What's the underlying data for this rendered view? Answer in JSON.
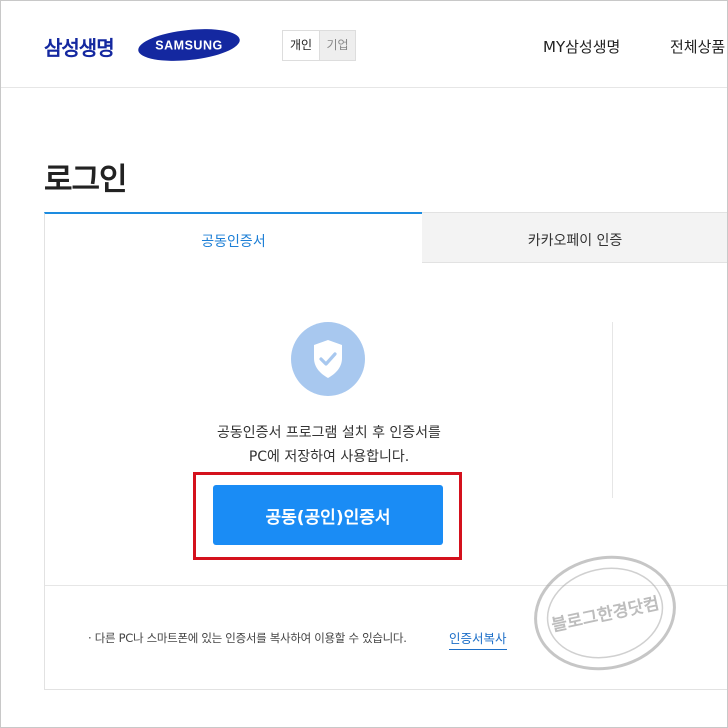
{
  "header": {
    "brand": "삼성생명",
    "partner_logo": "SAMSUNG",
    "segments": [
      "개인",
      "기업"
    ],
    "nav": [
      "MY삼성생명",
      "전체상품"
    ]
  },
  "page": {
    "title": "로그인"
  },
  "tabs": [
    {
      "label": "공동인증서",
      "active": true
    },
    {
      "label": "카카오페이 인증",
      "active": false
    }
  ],
  "cert_panel": {
    "icon": "shield-check-icon",
    "description_line1": "공동인증서 프로그램 설치 후 인증서를",
    "description_line2": "PC에 저장하여 사용합니다.",
    "button_label": "공동(공인)인증서"
  },
  "footer_note": {
    "text": "· 다른 PC나 스마트폰에 있는 인증서를 복사하여 이용할 수 있습니다.",
    "link_label": "인증서복사"
  },
  "watermark": {
    "text": "블로그한경닷컴"
  },
  "colors": {
    "brand_blue": "#1428a0",
    "accent_blue": "#1a8cf5",
    "highlight_red": "#d4111d",
    "shield_circle": "#a8c8ef"
  }
}
